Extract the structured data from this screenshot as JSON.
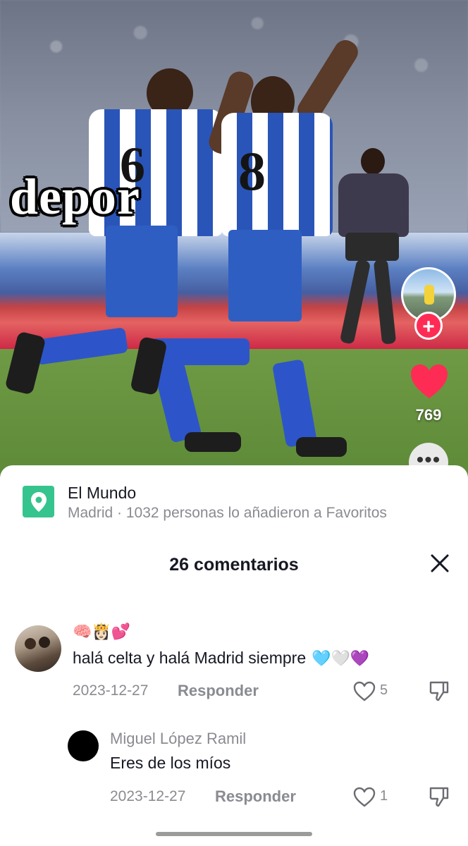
{
  "video": {
    "overlay_text": "depor",
    "player_left_number": "6",
    "player_right_number": "8",
    "like_count": "769",
    "more_glyph": "•••",
    "follow_glyph": "+",
    "colors": {
      "like": "#fe2c55",
      "follow": "#fe2c55"
    }
  },
  "location": {
    "name": "El Mundo",
    "subtitle": "Madrid · 1032 personas lo añadieron a Favoritos",
    "icon": "location-pin-icon",
    "color": "#36c48e"
  },
  "comments_header": {
    "title": "26 comentarios",
    "close_icon": "close-icon"
  },
  "comments": [
    {
      "emojis": "🧠👸🏻💕",
      "text": "halá celta y halá Madrid siempre",
      "hearts": "🩵🤍💜",
      "date": "2023-12-27",
      "reply_label": "Responder",
      "likes": "5"
    }
  ],
  "replies": [
    {
      "author": "Miguel López Ramil",
      "text": "Eres de los míos",
      "date": "2023-12-27",
      "reply_label": "Responder",
      "likes": "1"
    }
  ]
}
